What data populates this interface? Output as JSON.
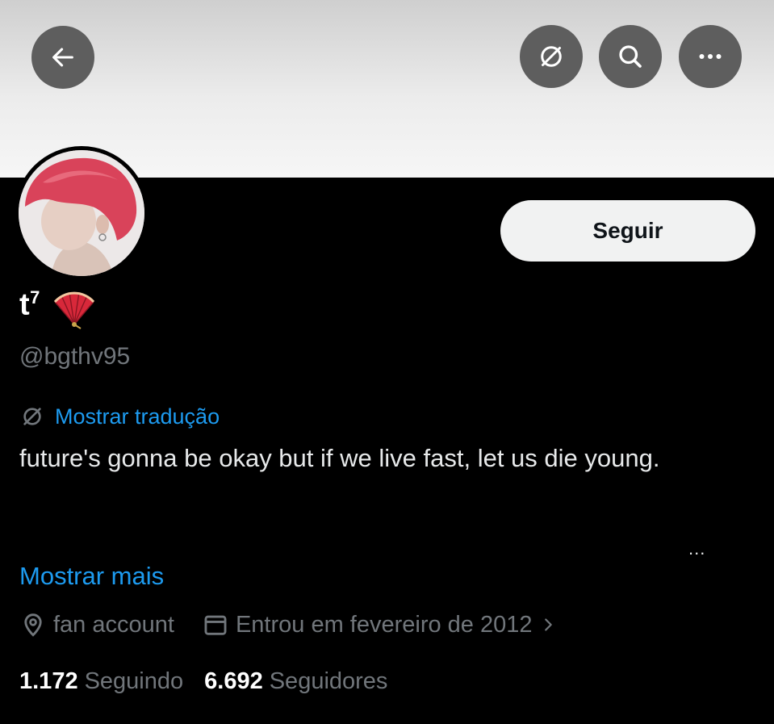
{
  "header": {
    "back_icon": "arrow-left-icon",
    "translate_icon": "translate-icon",
    "search_icon": "search-icon",
    "more_icon": "more-horizontal-icon"
  },
  "profile": {
    "name": "t",
    "name_superscript": "7",
    "name_emoji": "folding-fan-emoji",
    "handle": "@bgthv95",
    "follow_label": "Seguir"
  },
  "bio": {
    "translate_label": "Mostrar tradução",
    "text": "future's gonna be okay but if we live fast, let us die young.",
    "more_dots": "...",
    "show_more": "Mostrar mais"
  },
  "meta": {
    "location": "fan account",
    "joined": "Entrou em fevereiro de 2012"
  },
  "stats": {
    "following_count": "1.172",
    "following_label": "Seguindo",
    "followers_count": "6.692",
    "followers_label": "Seguidores"
  },
  "colors": {
    "accent": "#1d9bf0",
    "muted": "#71767b",
    "background": "#000000",
    "header_button": "#5e5e5e"
  }
}
